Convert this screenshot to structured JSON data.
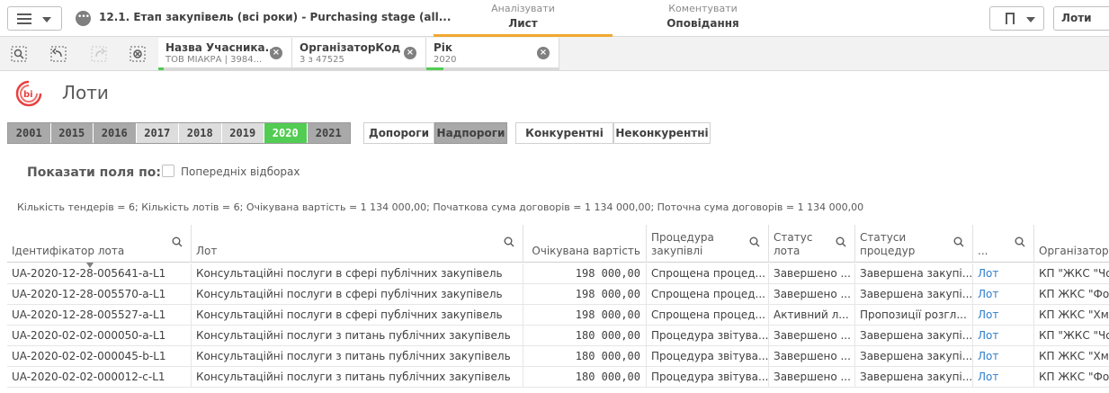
{
  "header": {
    "app_title": "12.1. Етап закупівель (всі роки) - Purchasing stage (all...",
    "app_icon_text": "•••",
    "tabs": [
      {
        "small": "Аналізувати",
        "big": "Лист"
      },
      {
        "small": "Коментувати",
        "big": "Оповідання"
      }
    ],
    "sheet_button_label": "Лоти"
  },
  "selections": [
    {
      "title": "Назва Учасника...",
      "sub": "ТОВ МІАКРА | 3984...",
      "fill": 0.04
    },
    {
      "title": "ОрганізаторКод",
      "sub": "3 з 47525",
      "fill": 0.0
    },
    {
      "title": "Рік",
      "sub": "2020",
      "fill": 0.13
    }
  ],
  "sheet": {
    "title": "Лоти"
  },
  "years": [
    {
      "label": "2001",
      "state": "excluded"
    },
    {
      "label": "2015",
      "state": "excluded"
    },
    {
      "label": "2016",
      "state": "excluded"
    },
    {
      "label": "2017",
      "state": "alternative"
    },
    {
      "label": "2018",
      "state": "alternative"
    },
    {
      "label": "2019",
      "state": "alternative"
    },
    {
      "label": "2020",
      "state": "selected"
    },
    {
      "label": "2021",
      "state": "excluded"
    }
  ],
  "thresholds": [
    {
      "label": "Допороги",
      "state": "normal"
    },
    {
      "label": "Надпороги",
      "state": "excluded"
    }
  ],
  "competition": [
    {
      "label": "Конкурентні"
    },
    {
      "label": "Неконкурентні"
    }
  ],
  "show_fields": {
    "label": "Показати поля по:",
    "checkbox_label": "Попередніх відборах"
  },
  "summary": "Кількість тендерів = 6; Кількість лотів = 6; Очікувана вартість = 1 134 000,00; Початкова сума договорів = 1 134 000,00; Поточна сума договорів = 1 134 000,00",
  "table": {
    "columns": [
      {
        "label": "Ідентифікатор лота"
      },
      {
        "label": "Лот"
      },
      {
        "label": "Очікувана вартість"
      },
      {
        "label": "Процедура закупівлі"
      },
      {
        "label": "Статус лота"
      },
      {
        "label": "Статуси процедур"
      },
      {
        "label": "..."
      },
      {
        "label": "Організатор"
      }
    ],
    "rows": [
      [
        "UA-2020-12-28-005641-a-L1",
        "Консультаційні послуги в сфері публічних закупівель",
        "198 000,00",
        "Спрощена процед...",
        "Завершено ...",
        "Завершена закупі...",
        "Лот",
        "КП \"ЖКС \"Чо"
      ],
      [
        "UA-2020-12-28-005570-a-L1",
        "Консультаційні послуги в сфері публічних закупівель",
        "198 000,00",
        "Спрощена процед...",
        "Завершено ...",
        "Завершена закупі...",
        "Лот",
        "КП ЖКС \"Фон"
      ],
      [
        "UA-2020-12-28-005527-a-L1",
        "Консультаційні послуги в сфері публічних закупівель",
        "198 000,00",
        "Спрощена процед...",
        "Активний л...",
        "Пропозиції розгл...",
        "Лот",
        "КП ЖКС \"Хме"
      ],
      [
        "UA-2020-02-02-000050-a-L1",
        "Консультаційні послуги з питань публічних закупівель",
        "180 000,00",
        "Процедура звітува...",
        "Завершено ...",
        "Завершена закупі...",
        "Лот",
        "КП \"ЖКС \"Чо"
      ],
      [
        "UA-2020-02-02-000045-b-L1",
        "Консультаційні послуги з питань публічних закупівель",
        "180 000,00",
        "Процедура звітува...",
        "Завершено ...",
        "Завершена закупі...",
        "Лот",
        "КП ЖКС \"Хме"
      ],
      [
        "UA-2020-02-02-000012-c-L1",
        "Консультаційні послуги з питань публічних закупівель",
        "180 000,00",
        "Процедура звітува...",
        "Завершено ...",
        "Завершена закупі...",
        "Лот",
        "КП ЖКС \"Фон"
      ]
    ]
  }
}
